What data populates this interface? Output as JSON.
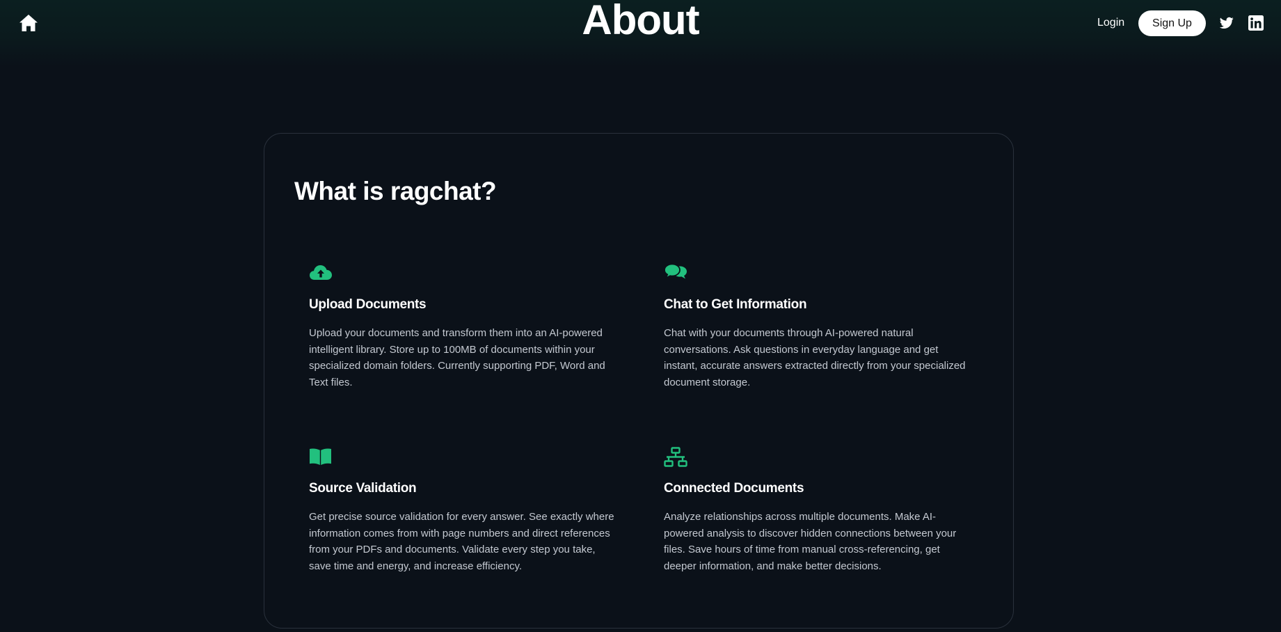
{
  "header": {
    "title": "About",
    "login_label": "Login",
    "signup_label": "Sign Up",
    "icons": [
      "home-icon",
      "twitter-icon",
      "linkedin-icon"
    ]
  },
  "colors": {
    "accent": "#22c07e",
    "background": "#0b1119",
    "card_border": "#2a313c"
  },
  "about": {
    "title": "What is ragchat?",
    "features": [
      {
        "icon": "cloud-upload-icon",
        "title": "Upload Documents",
        "description": "Upload your documents and transform them into an AI-powered intelligent library. Store up to 100MB of documents within your specialized domain folders. Currently supporting PDF, Word and Text files."
      },
      {
        "icon": "chat-bubbles-icon",
        "title": "Chat to Get Information",
        "description": "Chat with your documents through AI-powered natural conversations. Ask questions in everyday language and get instant, accurate answers extracted directly from your specialized document storage."
      },
      {
        "icon": "open-book-icon",
        "title": "Source Validation",
        "description": "Get precise source validation for every answer. See exactly where information comes from with page numbers and direct references from your PDFs and documents. Validate every step you take, save time and energy, and increase efficiency."
      },
      {
        "icon": "network-icon",
        "title": "Connected Documents",
        "description": "Analyze relationships across multiple documents. Make AI-powered analysis to discover hidden connections between your files. Save hours of time from manual cross-referencing, get deeper information, and make better decisions."
      }
    ]
  }
}
